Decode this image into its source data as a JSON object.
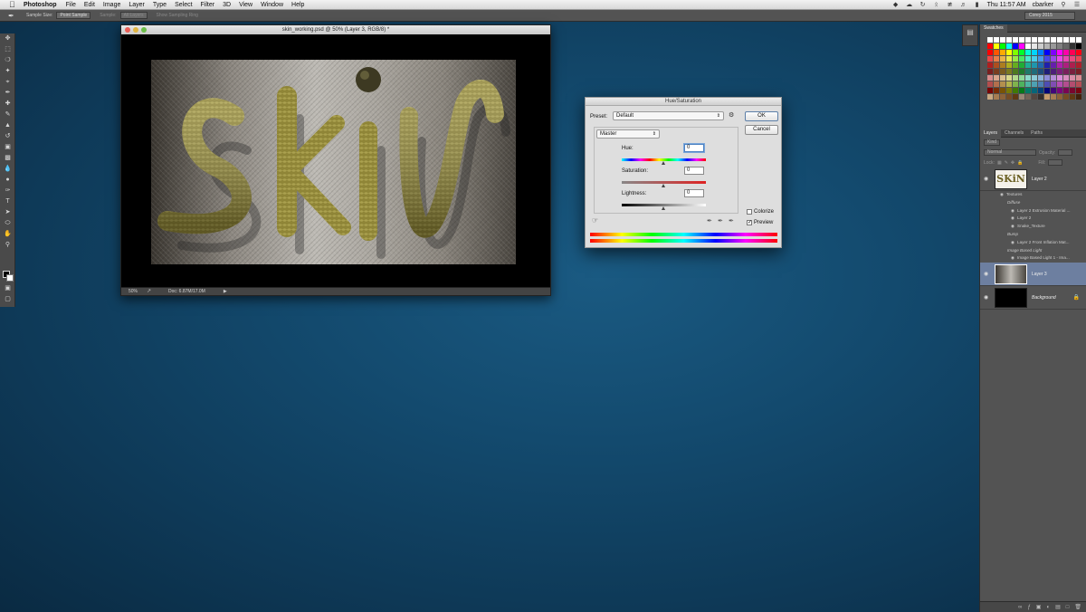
{
  "menubar": {
    "app_name": "Photoshop",
    "menus": [
      "File",
      "Edit",
      "Image",
      "Layer",
      "Type",
      "Select",
      "Filter",
      "3D",
      "View",
      "Window",
      "Help"
    ],
    "clock": "Thu 11:57 AM",
    "user": "cbarker"
  },
  "options_bar": {
    "sample_size_label": "Sample Size:",
    "sample_size_value": "Point Sample",
    "sample_label": "Sample:",
    "sample_value": "All Layers",
    "show_ring_label": "Show Sampling Ring",
    "workspace": "Corey 2015"
  },
  "document": {
    "title": "skin_working.psd @ 50% (Layer 3, RGB/8) *",
    "zoom": "50%",
    "doc_size": "Doc: 6.87M/17.0M",
    "artwork_text": "SKiN",
    "colors": {
      "metal_dark": "#3a3630",
      "metal_light": "#bdbab4",
      "letter_gold": "#8f8537"
    }
  },
  "huesat_dialog": {
    "title": "Hue/Saturation",
    "preset_label": "Preset:",
    "preset_value": "Default",
    "ok_label": "OK",
    "cancel_label": "Cancel",
    "channel_value": "Master",
    "hue_label": "Hue:",
    "hue_value": "0",
    "saturation_label": "Saturation:",
    "saturation_value": "0",
    "lightness_label": "Lightness:",
    "lightness_value": "0",
    "colorize_label": "Colorize",
    "colorize_checked": false,
    "preview_label": "Preview",
    "preview_checked": true
  },
  "swatches_panel": {
    "tab": "Swatches"
  },
  "layers_panel": {
    "tabs": [
      "Layers",
      "Channels",
      "Paths"
    ],
    "kind_filter": "Kind",
    "blend_mode": "Normal",
    "opacity_label": "Opacity:",
    "lock_label": "Lock:",
    "fill_label": "Fill:",
    "layers": [
      {
        "name": "Layer 2",
        "thumb_text": "SKiN",
        "effects": [
          {
            "level": 1,
            "label": "Textures"
          },
          {
            "level": 2,
            "label": "Diffuse"
          },
          {
            "level": 3,
            "label": "Layer 2 Extrusion Material ..."
          },
          {
            "level": 3,
            "label": "Layer 2"
          },
          {
            "level": 3,
            "label": "Snake_Texture"
          },
          {
            "level": 2,
            "label": "Bump"
          },
          {
            "level": 3,
            "label": "Layer 2 Front Inflation Mat..."
          },
          {
            "level": 2,
            "label": "Image Based Light"
          },
          {
            "level": 3,
            "label": "Image Based Light 1 - Ima..."
          }
        ]
      },
      {
        "name": "Layer 3",
        "selected": true
      },
      {
        "name": "Background",
        "locked": true
      }
    ]
  }
}
